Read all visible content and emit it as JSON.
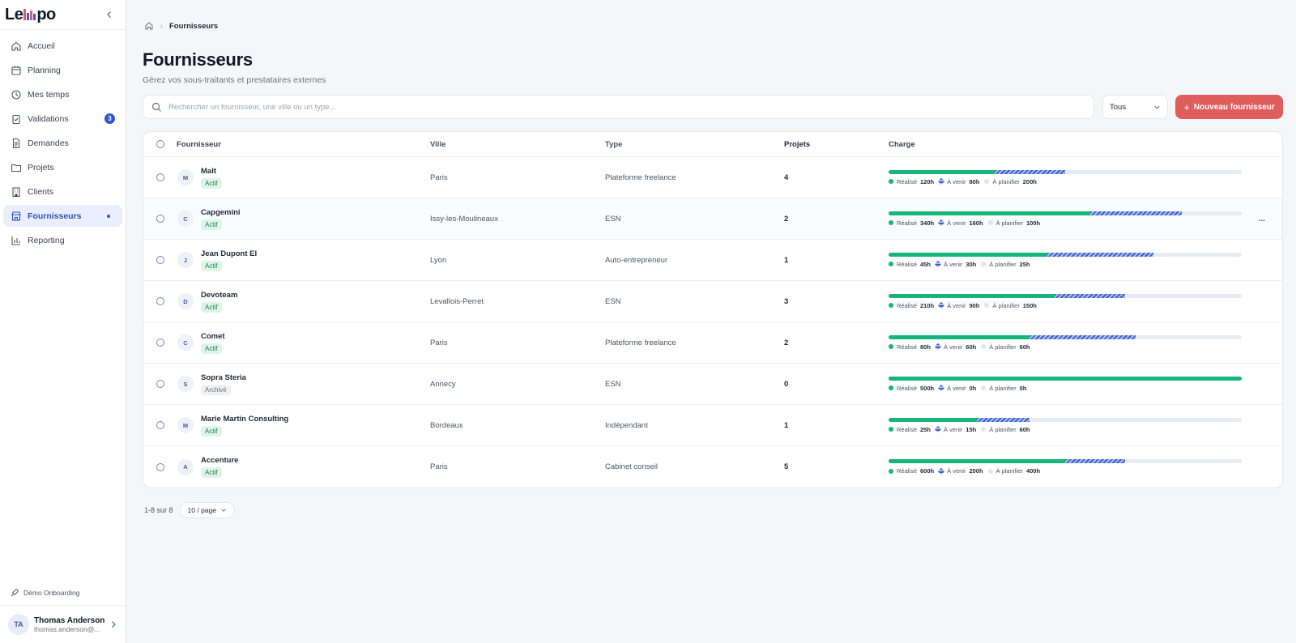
{
  "brand": {
    "logo_text_start": "Le",
    "logo_text_end": "po",
    "bar_colors": [
      "#e25c5c",
      "#3b5fd0",
      "#e25c5c",
      "#3b5fd0"
    ]
  },
  "sidebar": {
    "items": [
      {
        "label": "Accueil",
        "icon": "home-icon"
      },
      {
        "label": "Planning",
        "icon": "calendar-icon"
      },
      {
        "label": "Mes temps",
        "icon": "clock-icon"
      },
      {
        "label": "Validations",
        "icon": "clipboard-check-icon",
        "badge": "3"
      },
      {
        "label": "Demandes",
        "icon": "document-icon"
      },
      {
        "label": "Projets",
        "icon": "folder-icon"
      },
      {
        "label": "Clients",
        "icon": "building-icon"
      },
      {
        "label": "Fournisseurs",
        "icon": "store-icon",
        "active": true
      },
      {
        "label": "Reporting",
        "icon": "bar-chart-icon"
      }
    ],
    "onboarding": "Démo Onboarding",
    "user": {
      "initials": "TA",
      "name": "Thomas Anderson",
      "email": "thomas.anderson@..."
    }
  },
  "breadcrumb": {
    "current": "Fournisseurs"
  },
  "page": {
    "title": "Fournisseurs",
    "subtitle": "Gérez vos sous-traitants et prestataires externes"
  },
  "toolbar": {
    "search_placeholder": "Rechercher un fournisseur, une ville ou un type...",
    "filter_value": "Tous",
    "new_button": "Nouveau fournisseur"
  },
  "table": {
    "columns": {
      "supplier": "Fournisseur",
      "city": "Ville",
      "type": "Type",
      "projects": "Projets",
      "charge": "Charge"
    },
    "legend_labels": {
      "done": "Réalisé",
      "upcoming": "À venir",
      "todo": "À planifier"
    },
    "colors": {
      "done": "#16b57a",
      "upcoming": "#3b5fd0",
      "todo": "#e7ebf2"
    },
    "rows": [
      {
        "initial": "M",
        "name": "Malt",
        "status": "Actif",
        "city": "Paris",
        "type": "Plateforme freelance",
        "projects": "4",
        "done": "120h",
        "upcoming": "80h",
        "todo": "200h",
        "done_pct": 30,
        "upcoming_pct": 20
      },
      {
        "initial": "C",
        "name": "Capgemini",
        "status": "Actif",
        "city": "Issy-les-Moulineaux",
        "type": "ESN",
        "projects": "2",
        "done": "340h",
        "upcoming": "160h",
        "todo": "100h",
        "done_pct": 57,
        "upcoming_pct": 26
      },
      {
        "initial": "J",
        "name": "Jean Dupont EI",
        "status": "Actif",
        "city": "Lyon",
        "type": "Auto-entrepreneur",
        "projects": "1",
        "done": "45h",
        "upcoming": "30h",
        "todo": "25h",
        "done_pct": 45,
        "upcoming_pct": 30
      },
      {
        "initial": "D",
        "name": "Devoteam",
        "status": "Actif",
        "city": "Levallois-Perret",
        "type": "ESN",
        "projects": "3",
        "done": "210h",
        "upcoming": "90h",
        "todo": "150h",
        "done_pct": 47,
        "upcoming_pct": 20
      },
      {
        "initial": "C",
        "name": "Comet",
        "status": "Actif",
        "city": "Paris",
        "type": "Plateforme freelance",
        "projects": "2",
        "done": "80h",
        "upcoming": "60h",
        "todo": "60h",
        "done_pct": 40,
        "upcoming_pct": 30
      },
      {
        "initial": "S",
        "name": "Sopra Steria",
        "status": "Archivé",
        "city": "Annecy",
        "type": "ESN",
        "projects": "0",
        "done": "500h",
        "upcoming": "0h",
        "todo": "0h",
        "done_pct": 100,
        "upcoming_pct": 0
      },
      {
        "initial": "M",
        "name": "Marie Martin Consulting",
        "status": "Actif",
        "city": "Bordeaux",
        "type": "Indépendant",
        "projects": "1",
        "done": "25h",
        "upcoming": "15h",
        "todo": "60h",
        "done_pct": 25,
        "upcoming_pct": 15
      },
      {
        "initial": "A",
        "name": "Accenture",
        "status": "Actif",
        "city": "Paris",
        "type": "Cabinet conseil",
        "projects": "5",
        "done": "600h",
        "upcoming": "200h",
        "todo": "400h",
        "done_pct": 50,
        "upcoming_pct": 17
      }
    ],
    "row_menu": "..."
  },
  "pagination": {
    "summary": "1-8 sur 8",
    "page_size": "10 / page"
  }
}
